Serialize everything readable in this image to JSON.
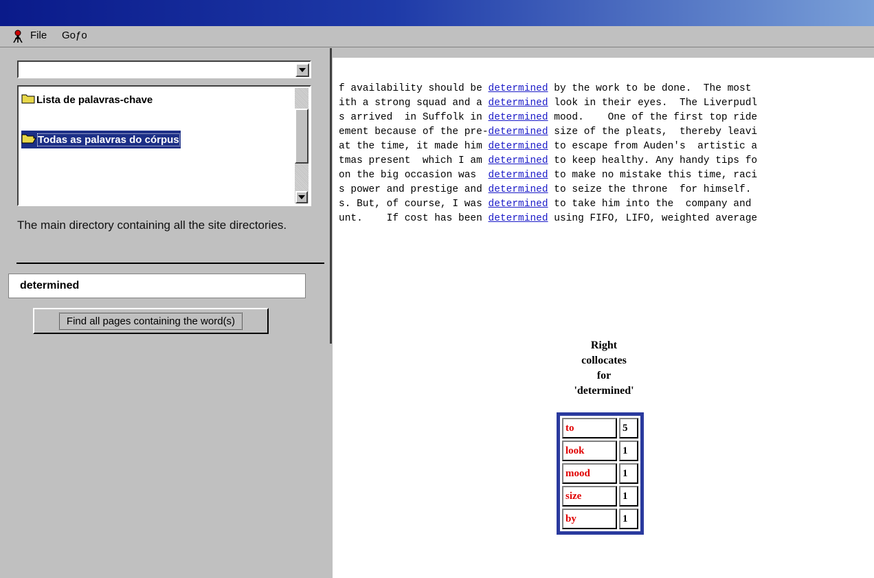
{
  "menu": {
    "file": "File",
    "goto": "Goƒo"
  },
  "tree": {
    "items": [
      {
        "label": "Lista de palavras-chave"
      },
      {
        "label": "Todas as palavras do córpus"
      }
    ]
  },
  "description": "The main directory containing all the site directories.",
  "search": {
    "value": "determined",
    "button": "Find all pages containing the word(s)"
  },
  "concordance": [
    {
      "left": "f availability should be ",
      "node": "determined",
      "right": " by the work to be done.  The most"
    },
    {
      "left": "ith a strong squad and a ",
      "node": "determined",
      "right": " look in their eyes.  The Liverpudl"
    },
    {
      "left": "s arrived  in Suffolk in ",
      "node": "determined",
      "right": " mood.    One of the first top ride"
    },
    {
      "left": "ement because of the pre-",
      "node": "determined",
      "right": " size of the pleats,  thereby leavi"
    },
    {
      "left": "at the time, it made him ",
      "node": "determined",
      "right": " to escape from Auden's  artistic a"
    },
    {
      "left": "tmas present  which I am ",
      "node": "determined",
      "right": " to keep healthy. Any handy tips fo"
    },
    {
      "left": "on the big occasion was  ",
      "node": "determined",
      "right": " to make no mistake this time, raci"
    },
    {
      "left": "s power and prestige and ",
      "node": "determined",
      "right": " to seize the throne  for himself."
    },
    {
      "left": "s. But, of course, I was ",
      "node": "determined",
      "right": " to take him into the  company and"
    },
    {
      "left": "unt.    If cost has been ",
      "node": "determined",
      "right": " using FIFO, LIFO, weighted average"
    }
  ],
  "collocates": {
    "title_lines": [
      "Right",
      "collocates",
      "for",
      "'determined'"
    ],
    "rows": [
      {
        "word": "to",
        "count": "5"
      },
      {
        "word": "look",
        "count": "1"
      },
      {
        "word": "mood",
        "count": "1"
      },
      {
        "word": "size",
        "count": "1"
      },
      {
        "word": "by",
        "count": "1"
      }
    ]
  },
  "colors": {
    "title_bar": "#0a1a8a",
    "selection": "#1c2f86",
    "link": "#1a1ac8",
    "collocate_word": "#e00000",
    "table_border": "#2a3a9e"
  }
}
